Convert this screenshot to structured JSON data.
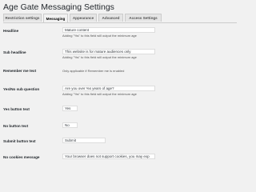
{
  "page": {
    "title": "Age Gate Messaging Settings"
  },
  "tabs": [
    {
      "label": "Restriction settings",
      "active": false
    },
    {
      "label": "Messaging",
      "active": true
    },
    {
      "label": "Appearance",
      "active": false
    },
    {
      "label": "Advanced",
      "active": false
    },
    {
      "label": "Access Settings",
      "active": false
    }
  ],
  "fields": {
    "headline": {
      "label": "Headline",
      "value": "Mature content",
      "description": "Adding \"%s\" to this field will output the minimum age"
    },
    "sub_headline": {
      "label": "Sub headline",
      "value": "This website is for mature audiences only",
      "description": "Adding \"%s\" to this field will output the minimum age"
    },
    "remember_me": {
      "label": "Remember me text",
      "description": "Only applicable if Remember me is enabled"
    },
    "yes_no_question": {
      "label": "Yes/No sub question",
      "value": "Are you over %s years of age?",
      "description": "Adding \"%s\" to this field will output the minimum age"
    },
    "yes_button": {
      "label": "Yes button text",
      "value": "Yes"
    },
    "no_button": {
      "label": "No button text",
      "value": "No"
    },
    "submit_button": {
      "label": "Submit button text",
      "value": "Submit"
    },
    "no_cookies": {
      "label": "No cookies message",
      "value": "Your browser does not support cookies, you may exp"
    }
  }
}
